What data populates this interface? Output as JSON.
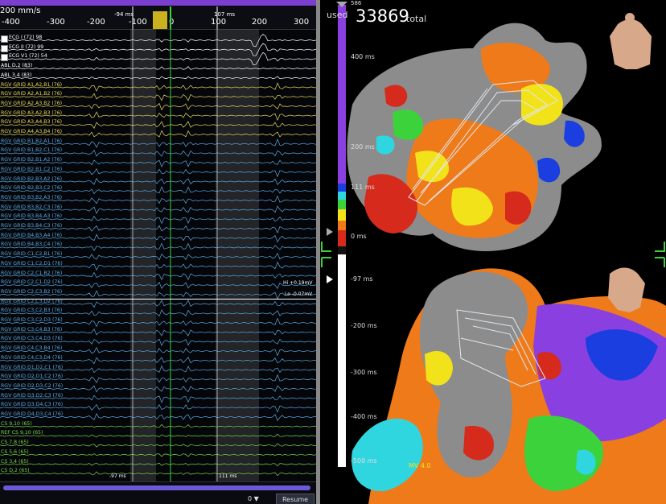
{
  "ecg": {
    "speed": "200 mm/s",
    "marker_left": "-94 ms",
    "marker_right": "107 ms",
    "ticks": [
      "-400",
      "-300",
      "-200",
      "-100",
      "0",
      "100",
      "200",
      "300"
    ],
    "hi_label": "Hi +0.19mV",
    "lo_label": "Lo -0.07mV",
    "bottom_left": "-97 ms",
    "bottom_right": "111 ms",
    "zero_select": "0",
    "resume": "Resume",
    "leads": [
      "ECG I (72)  98",
      "ECG II (72)  99",
      "ECG V1 (72)  54",
      "ABL D,2 (83)",
      "ABL 3,4 (83)",
      "RGV GRID  A1,A2,B1 (76)",
      "RGV GRID  A2,A1,B2 (76)",
      "RGV GRID  A2,A3,B2 (76)",
      "RGV GRID  A3,A2,B3 (76)",
      "RGV GRID  A3,A4,B3 (76)",
      "RGV GRID  A4,A3,B4 (76)",
      "RGV GRID  B1,B2,A1 (76)",
      "RGV GRID  B1,B2,C1 (76)",
      "RGV GRID  B2,B1,A2 (76)",
      "RGV GRID  B2,B1,C2 (76)",
      "RGV GRID  B2,B3,A2 (76)",
      "RGV GRID  B2,B3,C2 (76)",
      "RGV GRID  B3,B2,A3 (76)",
      "RGV GRID  B3,B2,C3 (76)",
      "RGV GRID  B3,B4,A3 (76)",
      "RGV GRID  B3,B4,C3 (76)",
      "RGV GRID  B4,B3,A4 (76)",
      "RGV GRID  B4,B3,C4 (76)",
      "RGV GRID  C1,C2,B1 (76)",
      "RGV GRID  C1,C2,D1 (76)",
      "RGV GRID  C2,C1,B2 (76)",
      "RGV GRID  C2,C1,D2 (76)",
      "RGV GRID  C2,C3,B2 (76)",
      "RGV GRID  C2,C3,D2 (76)",
      "RGV GRID  C3,C2,B3 (76)",
      "RGV GRID  C3,C2,D3 (76)",
      "RGV GRID  C3,C4,B3 (76)",
      "RGV GRID  C3,C4,D3 (76)",
      "RGV GRID  C4,C3,B4 (76)",
      "RGV GRID  C4,C3,D4 (76)",
      "RGV GRID  D1,D2,C1 (76)",
      "RGV GRID  D2,D1,C2 (76)",
      "RGV GRID  D2,D3,C2 (76)",
      "RGV GRID  D3,D2,C3 (76)",
      "RGV GRID  D3,D4,C3 (76)",
      "RGV GRID  D4,D3,C4 (76)",
      "CS 9,10 (65)",
      "REF CS 9,10 (65)",
      "CS 7,8 (65)",
      "CS 5,6 (65)",
      "CS 3,4 (65)",
      "CS D,2 (65)"
    ]
  },
  "map": {
    "used_label": "used",
    "point_count": "33869",
    "total_label": "total",
    "top_scale": [
      "586",
      "400 ms",
      "200 ms",
      "111 ms",
      "0 ms"
    ],
    "bottom_scale": [
      "-97 ms",
      "-200 ms",
      "-300 ms",
      "-400 ms",
      "-500 ms"
    ],
    "mv_label": "MV 4.0"
  },
  "colors": {
    "scale_purple": "#8a3fe0",
    "red": "#d62a1c",
    "orange": "#ef7a1a",
    "yellow": "#f2e21a",
    "green": "#3cd23c",
    "cyan": "#2fd6e0",
    "blue": "#1a3ee0",
    "gray": "#8c8c8c"
  }
}
